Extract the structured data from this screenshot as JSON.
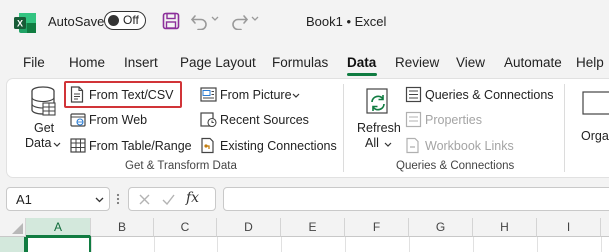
{
  "titlebar": {
    "autosave_label": "AutoSave",
    "autosave_state": "Off",
    "title": "Book1 • Excel",
    "icons": [
      "excel-logo",
      "save-icon",
      "undo-icon",
      "redo-icon"
    ]
  },
  "tabs": [
    {
      "label": "File"
    },
    {
      "label": "Home"
    },
    {
      "label": "Insert"
    },
    {
      "label": "Page Layout"
    },
    {
      "label": "Formulas"
    },
    {
      "label": "Data",
      "active": true
    },
    {
      "label": "Review"
    },
    {
      "label": "View"
    },
    {
      "label": "Automate"
    },
    {
      "label": "Help"
    }
  ],
  "ribbon": {
    "get_data": {
      "line1": "Get",
      "line2": "Data"
    },
    "from_text_csv": "From Text/CSV",
    "from_web": "From Web",
    "from_table_range": "From Table/Range",
    "from_picture": "From Picture",
    "recent_sources": "Recent Sources",
    "existing_connections": "Existing Connections",
    "group1_label": "Get & Transform Data",
    "refresh": {
      "line1": "Refresh",
      "line2": "All"
    },
    "queries_connections": "Queries & Connections",
    "properties": "Properties",
    "workbook_links": "Workbook Links",
    "group2_label": "Queries & Connections",
    "org_partial": "Orga"
  },
  "formula_bar": {
    "name_box": "A1",
    "fx": "fx",
    "formula": ""
  },
  "columns": [
    "A",
    "B",
    "C",
    "D",
    "E",
    "F",
    "G",
    "H",
    "I"
  ],
  "colors": {
    "accent": "#107c41",
    "highlight": "#d13438"
  }
}
